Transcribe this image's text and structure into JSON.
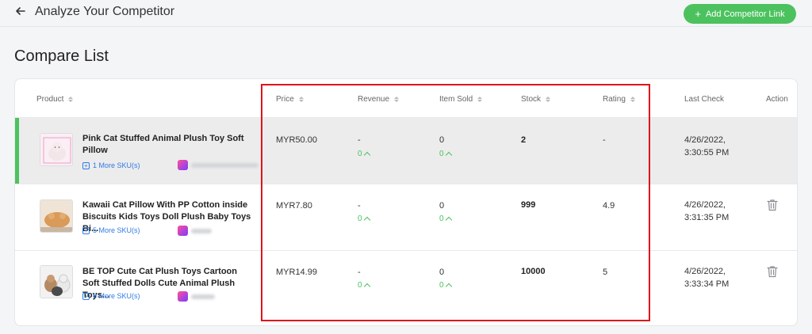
{
  "header": {
    "title": "Analyze Your Competitor",
    "add_button_label": "Add Competitor Link"
  },
  "page_title": "Compare List",
  "table": {
    "columns": [
      "Product",
      "Price",
      "Revenue",
      "Item Sold",
      "Stock",
      "Rating",
      "Last Check",
      "Action"
    ],
    "rows": [
      {
        "name": "Pink Cat Stuffed Animal Plush Toy Soft Pillow",
        "sku": "1 More SKU(s)",
        "price": "MYR50.00",
        "revenue": "-",
        "revenue_delta": "0",
        "item_sold": "0",
        "item_sold_delta": "0",
        "stock": "2",
        "rating": "-",
        "last_check_date": "4/26/2022,",
        "last_check_time": "3:30:55 PM"
      },
      {
        "name": "Kawaii Cat Pillow With PP Cotton inside Biscuits Kids Toys Doll Plush Baby Toys Bi...",
        "sku": "5 More SKU(s)",
        "price": "MYR7.80",
        "revenue": "-",
        "revenue_delta": "0",
        "item_sold": "0",
        "item_sold_delta": "0",
        "stock": "999",
        "rating": "4.9",
        "last_check_date": "4/26/2022,",
        "last_check_time": "3:31:35 PM"
      },
      {
        "name": "BE TOP Cute Cat Plush Toys Cartoon Soft Stuffed Dolls Cute Animal Plush Toys...",
        "sku": "8 More SKU(s)",
        "price": "MYR14.99",
        "revenue": "-",
        "revenue_delta": "0",
        "item_sold": "0",
        "item_sold_delta": "0",
        "stock": "10000",
        "rating": "5",
        "last_check_date": "4/26/2022,",
        "last_check_time": "3:33:34 PM"
      }
    ]
  },
  "colors": {
    "accent_green": "#4cc25f",
    "link_blue": "#2f7ae5",
    "highlight_red": "#e0141b"
  },
  "icons": [
    "arrow-left-icon",
    "plus-icon",
    "sort-icon",
    "expand-box-icon",
    "shop-logo-icon",
    "trend-up-icon",
    "trash-icon"
  ]
}
